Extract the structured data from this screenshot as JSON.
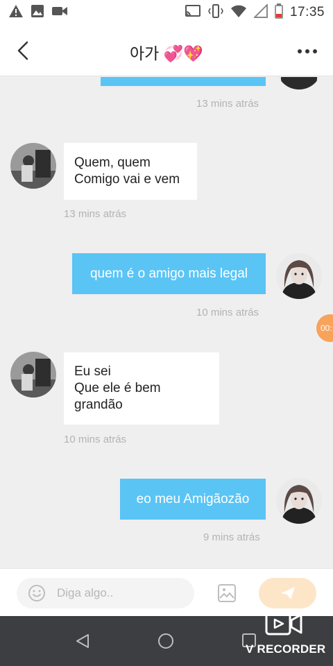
{
  "status_bar": {
    "time": "17:35",
    "left_icons": [
      "warning-icon",
      "image-icon",
      "video-icon"
    ],
    "right_icons": [
      "cast-icon",
      "vibrate-icon",
      "wifi-icon",
      "signal-icon",
      "battery-icon"
    ]
  },
  "header": {
    "title": "아가 💞💖",
    "back_icon": "chevron-left-icon",
    "more_icon": "more-icon"
  },
  "messages": [
    {
      "direction": "outgoing",
      "text": "",
      "timestamp": "13 mins atrás"
    },
    {
      "direction": "incoming",
      "text": "Quem, quem\nComigo vai e vem",
      "timestamp": "13 mins atrás"
    },
    {
      "direction": "outgoing",
      "text": "quem é o amigo mais legal",
      "timestamp": "10 mins atrás"
    },
    {
      "direction": "incoming",
      "text": "Eu sei\nQue ele é bem\ngrandão",
      "timestamp": "10 mins atrás"
    },
    {
      "direction": "outgoing",
      "text": "eo meu Amigãozão",
      "timestamp": "9 mins atrás"
    }
  ],
  "floating_badge": "00:",
  "input": {
    "placeholder": "Diga algo..",
    "value": ""
  },
  "recorder_label": "V RECORDER",
  "colors": {
    "outgoing_bubble": "#5ac4f5",
    "incoming_bubble": "#ffffff",
    "background": "#efefef",
    "send_button": "#fde6c8",
    "nav_bar": "#3c3e41"
  }
}
